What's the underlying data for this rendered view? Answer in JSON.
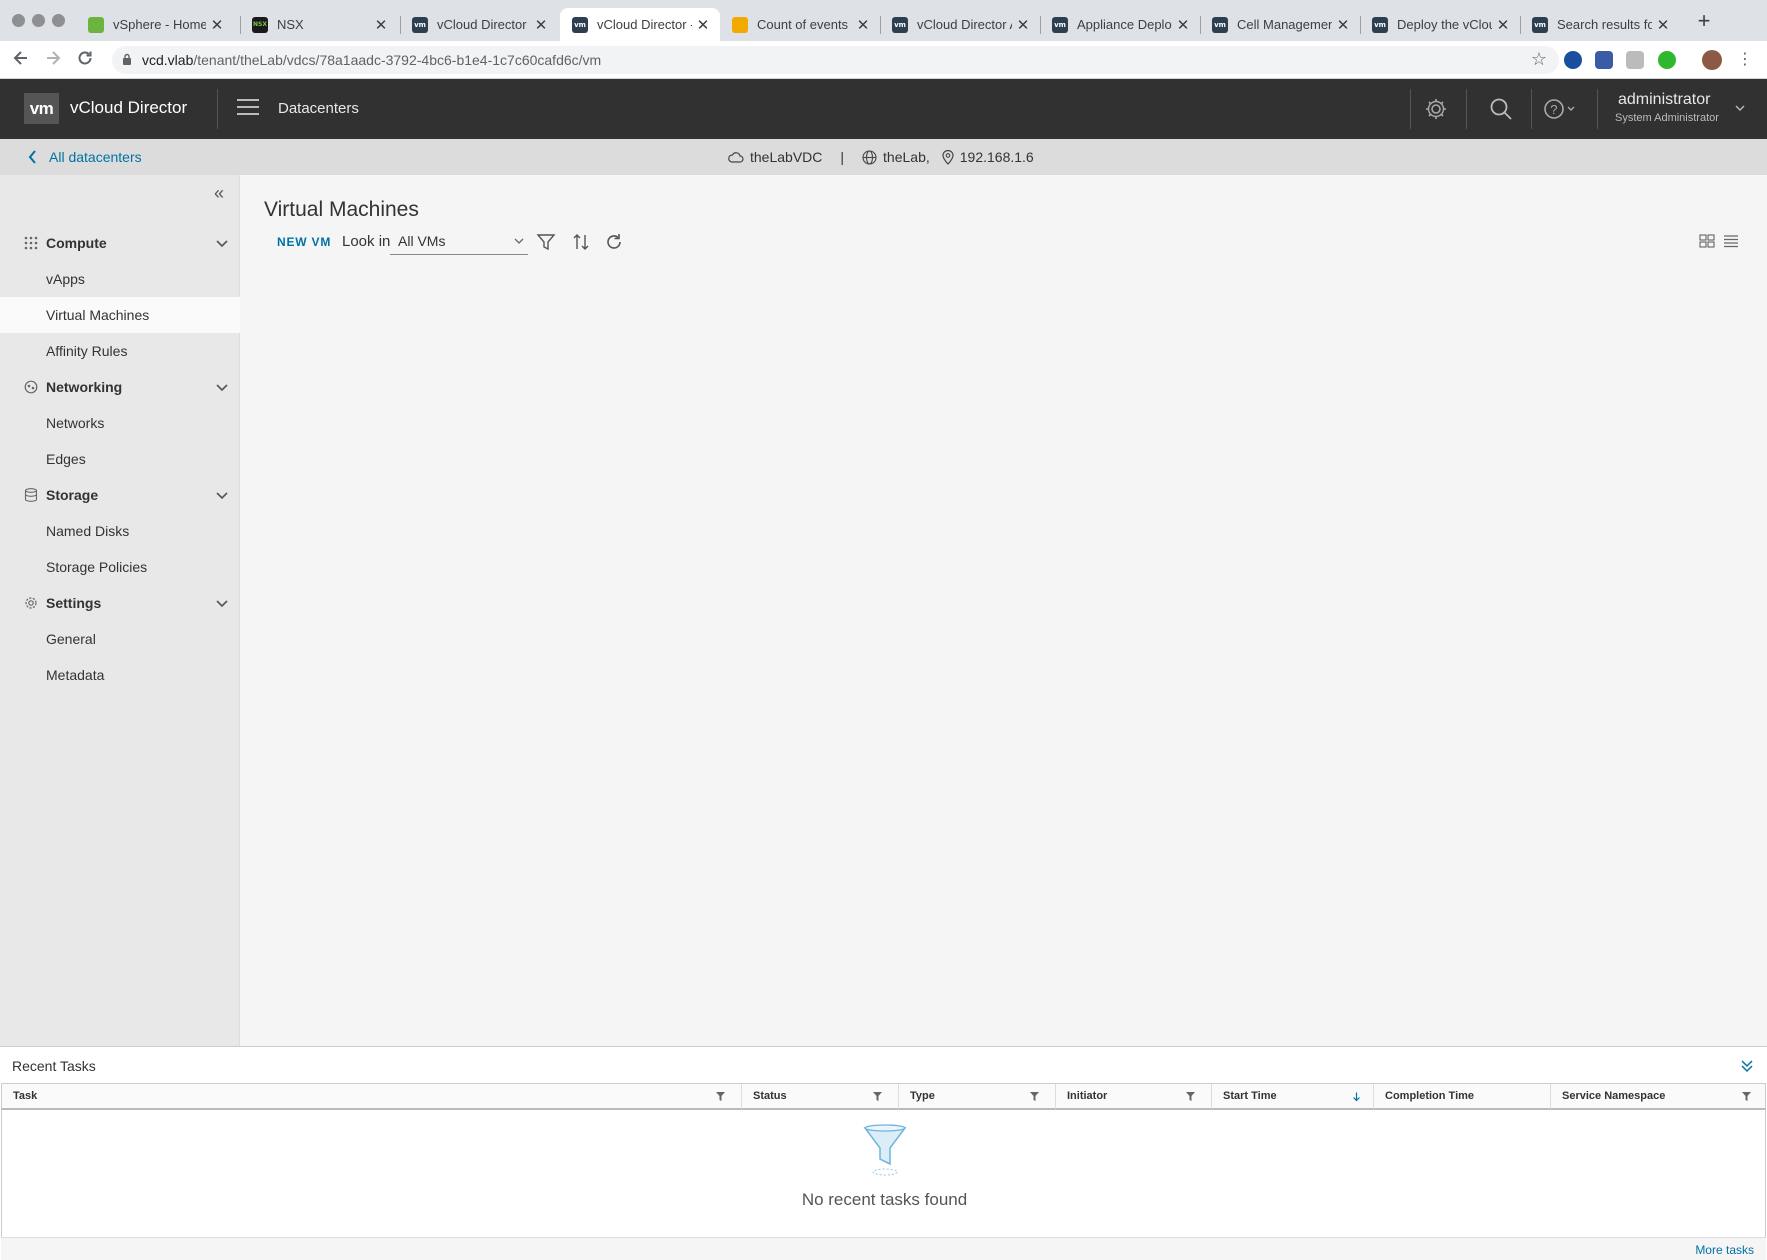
{
  "browser": {
    "tabs": [
      {
        "title": "vSphere - Home -",
        "favicon": "vsphere-icon"
      },
      {
        "title": "NSX",
        "favicon": "nsx-icon"
      },
      {
        "title": "vCloud Director -",
        "favicon": "vm-icon"
      },
      {
        "title": "vCloud Director -",
        "favicon": "vm-icon",
        "active": true
      },
      {
        "title": "Count of events o",
        "favicon": "chart-icon"
      },
      {
        "title": "vCloud Director A",
        "favicon": "vm-icon"
      },
      {
        "title": "Appliance Deploy",
        "favicon": "vm-icon"
      },
      {
        "title": "Cell Management",
        "favicon": "vm-icon"
      },
      {
        "title": "Deploy the vClou",
        "favicon": "vm-icon"
      },
      {
        "title": "Search results for",
        "favicon": "vm-icon"
      }
    ],
    "favicon_text": {
      "nsx": "NSX",
      "vm": "vm"
    },
    "new_tab": "+",
    "close_glyph": "✕",
    "url_host": "vcd.vlab",
    "url_path": "/tenant/theLab/vdcs/78a1aadc-3792-4bc6-b1e4-1c7c60cafd6c/vm"
  },
  "header": {
    "logo": "vm",
    "brand": "vCloud Director",
    "nav": "Datacenters",
    "user_name": "administrator",
    "user_role": "System Administrator"
  },
  "context": {
    "back_label": "All datacenters",
    "vdc": "theLabVDC",
    "separator": "|",
    "org": "theLab,",
    "ip": "192.168.1.6"
  },
  "sidebar": {
    "groups": [
      {
        "label": "Compute",
        "icon": "grid-icon",
        "items": [
          "vApps",
          "Virtual Machines",
          "Affinity Rules"
        ]
      },
      {
        "label": "Networking",
        "icon": "network-icon",
        "items": [
          "Networks",
          "Edges"
        ]
      },
      {
        "label": "Storage",
        "icon": "storage-icon",
        "items": [
          "Named Disks",
          "Storage Policies"
        ]
      },
      {
        "label": "Settings",
        "icon": "gear-icon",
        "items": [
          "General",
          "Metadata"
        ]
      }
    ],
    "active_item": "Virtual Machines"
  },
  "main": {
    "title": "Virtual Machines",
    "new_vm": "NEW VM",
    "look_in_label": "Look in",
    "look_in_value": "All VMs"
  },
  "tasks": {
    "title": "Recent Tasks",
    "columns": [
      "Task",
      "Status",
      "Type",
      "Initiator",
      "Start Time",
      "Completion Time",
      "Service Namespace"
    ],
    "empty": "No recent tasks found",
    "more": "More tasks"
  },
  "colors": {
    "header_bg": "#313131",
    "link": "#0072a3",
    "sidebar_bg": "#e8e8e8",
    "main_bg": "#f5f5f5"
  }
}
